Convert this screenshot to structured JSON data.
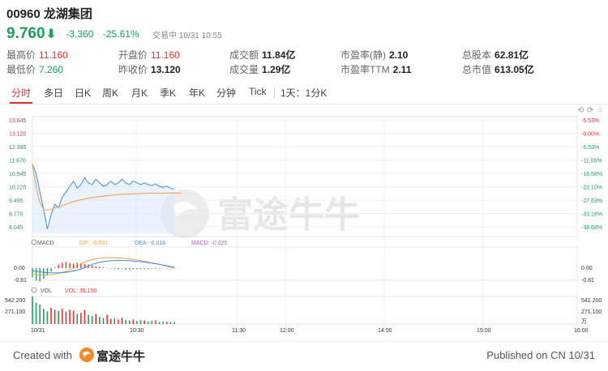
{
  "stock": {
    "code": "00960",
    "name": "龙湖集团",
    "price": "9.760",
    "change": "-3.360",
    "change_pct": "-25.61%",
    "status": "交易中 10/31 10:55"
  },
  "stats_row1": [
    {
      "label": "最高价",
      "value": "11.160",
      "tone": "red"
    },
    {
      "label": "开盘价",
      "value": "11.160",
      "tone": "red"
    },
    {
      "label": "成交额",
      "value": "11.84亿",
      "tone": "dark"
    },
    {
      "label": "市盈率(静)",
      "value": "2.10",
      "tone": "dark"
    },
    {
      "label": "总股本",
      "value": "62.81亿",
      "tone": "dark"
    }
  ],
  "stats_row2": [
    {
      "label": "最低价",
      "value": "7.260",
      "tone": "green"
    },
    {
      "label": "昨收价",
      "value": "13.120",
      "tone": "dark"
    },
    {
      "label": "成交量",
      "value": "1.29亿",
      "tone": "dark"
    },
    {
      "label": "市盈率TTM",
      "value": "2.11",
      "tone": "dark"
    },
    {
      "label": "总市值",
      "value": "613.05亿",
      "tone": "dark"
    }
  ],
  "tabs": [
    "分时",
    "多日",
    "日K",
    "周K",
    "月K",
    "季K",
    "年K",
    "分钟",
    "Tick",
    "1天：1分K"
  ],
  "active_tab": "分时",
  "icons": {
    "undo": "undo-icon",
    "redo": "redo-icon",
    "reset": "reset-icon"
  },
  "colors": {
    "up": "#e93030",
    "down": "#19a15f",
    "price_line": "#3d8ee8",
    "avg_line": "#f0a040",
    "fill": "#dbeafc"
  },
  "watermark": "富途牛牛",
  "chart_data": [
    {
      "type": "line",
      "name": "intraday",
      "ylim": [
        7.26,
        13.645
      ],
      "yticks_left": [
        "13.645",
        "13.120",
        "12.395",
        "11.670",
        "10.945",
        "10.220",
        "9.495",
        "8.770",
        "8.045"
      ],
      "yticks_right": [
        "-5.53%",
        "-0.00%",
        "-5.53%",
        "-11.05%",
        "-16.58%",
        "-22.10%",
        "-27.63%",
        "-33.16%",
        "-38.68%"
      ],
      "xticks": [
        "10/31",
        "10:30",
        "11:30",
        "12:00",
        "14:00",
        "15:00",
        "16:00"
      ],
      "price": [
        11.16,
        10.6,
        9.6,
        8.6,
        7.5,
        8.3,
        8.9,
        8.7,
        9.3,
        9.6,
        9.9,
        10.2,
        9.8,
        10.0,
        10.4,
        10.1,
        10.0,
        10.3,
        10.1,
        9.9,
        10.0,
        10.2,
        10.0,
        10.1,
        10.3,
        10.1,
        10.0,
        10.2,
        10.1,
        10.0,
        10.1,
        10.0,
        9.95,
        10.05,
        9.9,
        9.85,
        9.9,
        9.8,
        9.76
      ],
      "avg": [
        11.16,
        9.8,
        9.0,
        8.6,
        8.55,
        8.6,
        8.7,
        8.75,
        8.82,
        8.9,
        8.98,
        9.05,
        9.1,
        9.15,
        9.2,
        9.24,
        9.28,
        9.3,
        9.33,
        9.35,
        9.38,
        9.4,
        9.42,
        9.44,
        9.45,
        9.46,
        9.47,
        9.48,
        9.49,
        9.5,
        9.5,
        9.51,
        9.51,
        9.52,
        9.52,
        9.52,
        9.53,
        9.53,
        9.53
      ]
    },
    {
      "type": "bar",
      "name": "MACD",
      "label_dif": "DIF: -0.031",
      "label_dea": "DEA: -0.018",
      "label_macd": "MACD: -0.025",
      "yticks": [
        "0.00",
        "-0.81"
      ],
      "values": [
        -0.5,
        -0.7,
        -0.75,
        -0.6,
        -0.4,
        -0.2,
        0.05,
        0.2,
        0.3,
        0.35,
        0.3,
        0.25,
        0.3,
        0.28,
        0.22,
        0.2,
        0.15,
        0.1,
        0.08,
        0.05,
        0.02,
        -0.02,
        -0.05,
        -0.07,
        -0.06,
        -0.08,
        -0.07,
        -0.05,
        -0.06,
        -0.05,
        -0.04,
        -0.05,
        -0.03,
        -0.04,
        -0.03,
        -0.02,
        -0.03,
        -0.02,
        -0.025
      ]
    },
    {
      "type": "bar",
      "name": "VOL",
      "label_vol": "VOL: 35.150",
      "yticks": [
        "542.200",
        "271.100"
      ],
      "unit": "万",
      "ylim": [
        0,
        542.2
      ],
      "values": [
        542,
        420,
        380,
        300,
        250,
        320,
        280,
        260,
        300,
        240,
        280,
        260,
        200,
        220,
        280,
        180,
        160,
        200,
        140,
        120,
        180,
        100,
        110,
        90,
        120,
        80,
        70,
        90,
        60,
        80,
        70,
        50,
        60,
        70,
        40,
        50,
        45,
        40,
        35
      ]
    }
  ],
  "footer": {
    "created": "Created with",
    "brand": "富途牛牛",
    "published": "Published on CN 10/31"
  }
}
